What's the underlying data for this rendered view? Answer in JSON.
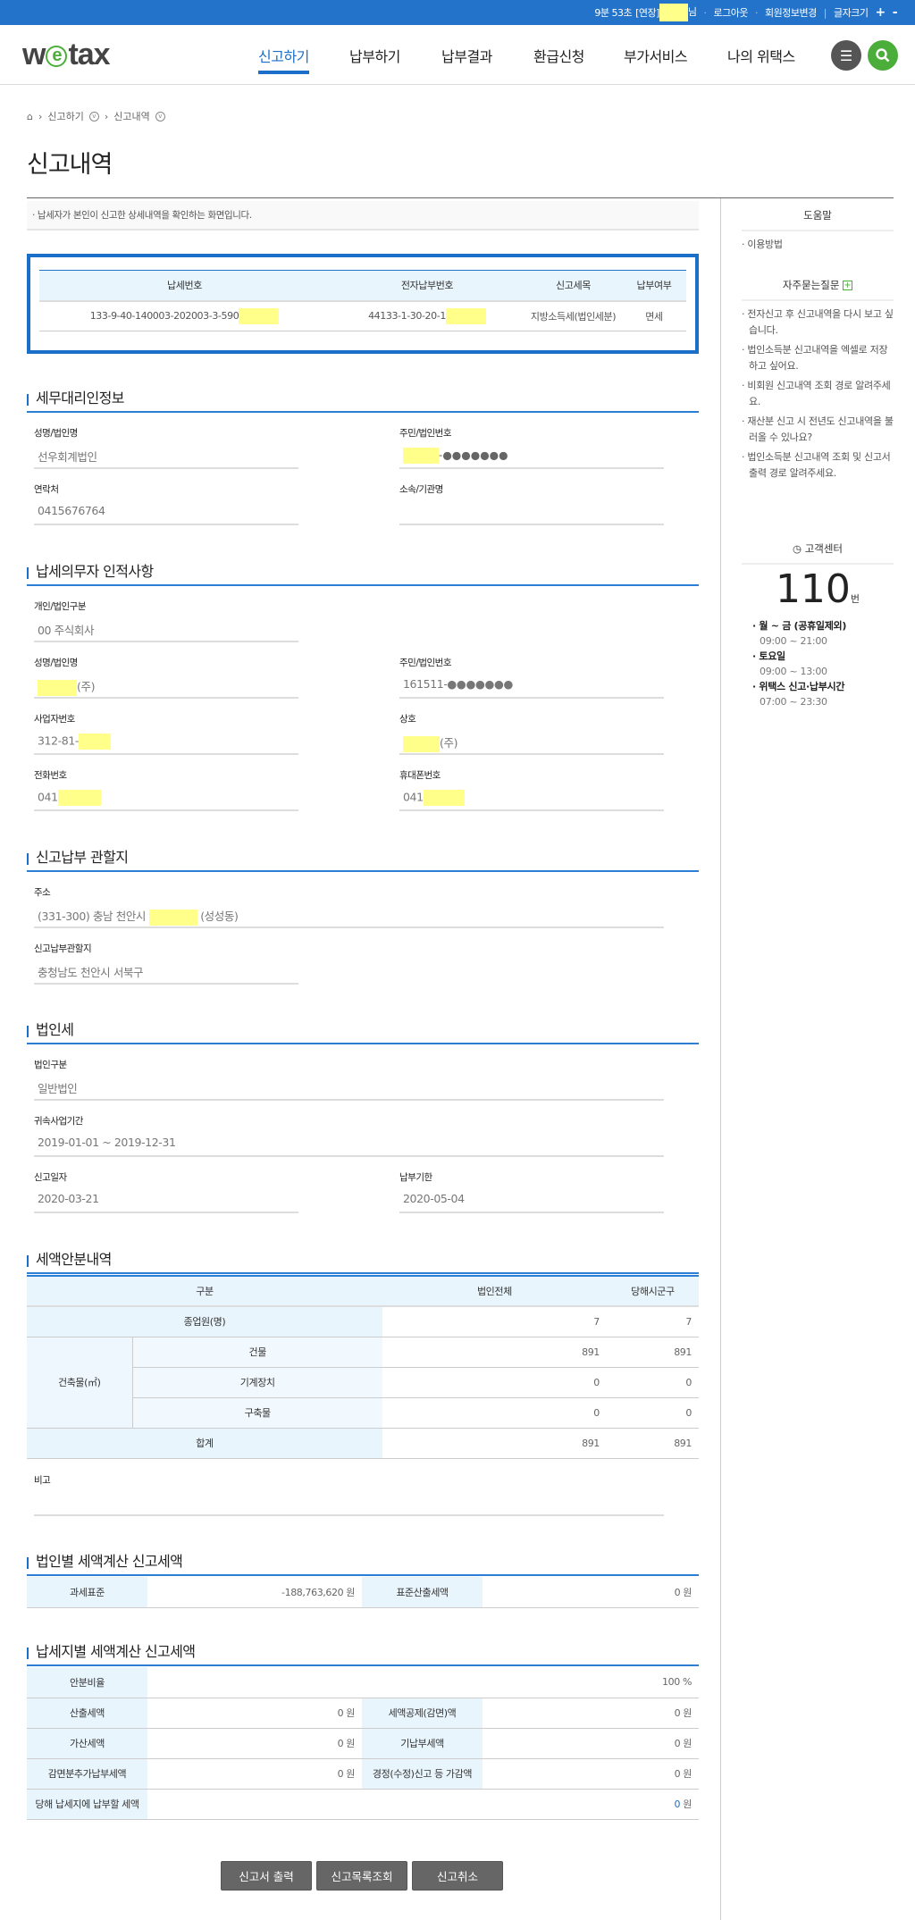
{
  "topbar": {
    "timer": "9분 53초",
    "extend": "[연장]",
    "user_suffix": "님",
    "logout": "로그아웃",
    "member_edit": "회원정보변경",
    "font_size": "글자크기",
    "plus": "+",
    "minus": "-"
  },
  "header": {
    "logo_pre": "w",
    "logo_e": "e",
    "logo_post": "tax",
    "nav": [
      "신고하기",
      "납부하기",
      "납부결과",
      "환급신청",
      "부가서비스",
      "나의 위택스"
    ]
  },
  "breadcrumb": [
    "신고하기",
    "신고내역"
  ],
  "page_title": "신고내역",
  "info_text": "· 납세자가 본인이 신고한 상세내역을 확인하는 화면입니다.",
  "report_table": {
    "headers": [
      "납세번호",
      "전자납부번호",
      "신고세목",
      "납부여부"
    ],
    "row": {
      "tax_no": "133-9-40-140003-202003-3-590",
      "epay_no": "44133-1-30-20-1",
      "item": "지방소득세(법인세분)",
      "status": "면세"
    },
    "status_color": "#e02020"
  },
  "agent": {
    "title": "세무대리인정보",
    "name_label": "성명/법인명",
    "name": "선우회계법인",
    "id_label": "주민/법인번호",
    "id_masked": "-●●●●●●●",
    "phone_label": "연락처",
    "phone": "0415676764",
    "org_label": "소속/기관명",
    "org": ""
  },
  "taxpayer": {
    "title": "납세의무자 인적사항",
    "type_label": "개인/법인구분",
    "type": "00 주식회사",
    "name_label": "성명/법인명",
    "name_suffix": "(주)",
    "id_label": "주민/법인번호",
    "id": "161511-●●●●●●●",
    "bizno_label": "사업자번호",
    "bizno": "312-81-",
    "trade_label": "상호",
    "trade_suffix": "(주)",
    "tel_label": "전화번호",
    "tel": "041",
    "mobile_label": "휴대폰번호",
    "mobile": "041"
  },
  "jurisdiction": {
    "title": "신고납부 관할지",
    "addr_label": "주소",
    "addr_pre": "(331-300) 충남 천안시",
    "addr_post": "(성성동)",
    "office_label": "신고납부관할지",
    "office": "충청남도 천안시 서북구"
  },
  "corp_tax": {
    "title": "법인세",
    "type_label": "법인구분",
    "type": "일반법인",
    "period_label": "귀속사업기간",
    "period": "2019-01-01 ~ 2019-12-31",
    "report_date_label": "신고일자",
    "report_date": "2020-03-21",
    "due_label": "납부기한",
    "due": "2020-05-04"
  },
  "allocation": {
    "title": "세액안분내역",
    "headers": [
      "구분",
      "법인전체",
      "당해시군구"
    ],
    "employees_label": "종업원(명)",
    "employees": [
      "7",
      "7"
    ],
    "building_label": "건축물(㎡)",
    "sub": [
      {
        "label": "건물",
        "values": [
          "891",
          "891"
        ]
      },
      {
        "label": "기계장치",
        "values": [
          "0",
          "0"
        ]
      },
      {
        "label": "구축물",
        "values": [
          "0",
          "0"
        ]
      }
    ],
    "total_label": "합계",
    "total": [
      "891",
      "891"
    ],
    "note_label": "비고",
    "note": ""
  },
  "corp_calc": {
    "title": "법인별 세액계산 신고세액",
    "base_label": "과세표준",
    "base": "-188,763,620 원",
    "std_label": "표준산출세액",
    "std": "0 원"
  },
  "local_calc": {
    "title": "납세지별 세액계산 신고세액",
    "ratio_label": "안분비율",
    "ratio": "100 %",
    "calc_label": "산출세액",
    "calc": "0 원",
    "credit_label": "세액공제(감면)액",
    "credit": "0 원",
    "add_label": "가산세액",
    "add": "0 원",
    "prepaid_label": "기납부세액",
    "prepaid": "0 원",
    "exempt_label": "감면분추가납부세액",
    "exempt": "0 원",
    "amend_label": "경정(수정)신고 등 가감액",
    "amend": "0 원",
    "pay_label": "당해 납세지에 납부할 세액",
    "pay_value": "0",
    "pay_unit": "원"
  },
  "buttons": {
    "print": "신고서 출력",
    "list": "신고목록조회",
    "cancel": "신고취소"
  },
  "sidebar": {
    "help_title": "도움말",
    "help_items": [
      "· 이용방법"
    ],
    "faq_title": "자주묻는질문",
    "faq_plus": "+",
    "faq": [
      "· 전자신고 후 신고내역을 다시 보고 싶습니다.",
      "· 법인소득분 신고내역을 엑셀로 저장하고 싶어요.",
      "· 비회원 신고내역 조회 경로 알려주세요.",
      "· 재산분 신고 시 전년도 신고내역을 불러올 수 있나요?",
      "· 법인소득분 신고내역 조회 및 신고서 출력 경로 알려주세요."
    ],
    "cs_title": "고객센터",
    "cs_number": "110",
    "cs_unit": "번",
    "hours": [
      {
        "label": "· 월 ~ 금 (공휴일제외)",
        "time": "09:00 ~ 21:00"
      },
      {
        "label": "· 토요일",
        "time": "09:00 ~ 13:00"
      },
      {
        "label": "· 위택스 신고·납부시간",
        "time": "07:00 ~ 23:30"
      }
    ]
  },
  "colors": {
    "primary": "#2273c9",
    "accent_green": "#4cae3a",
    "header_bg": "#e9f5fd",
    "redaction": "#ffff8a"
  }
}
